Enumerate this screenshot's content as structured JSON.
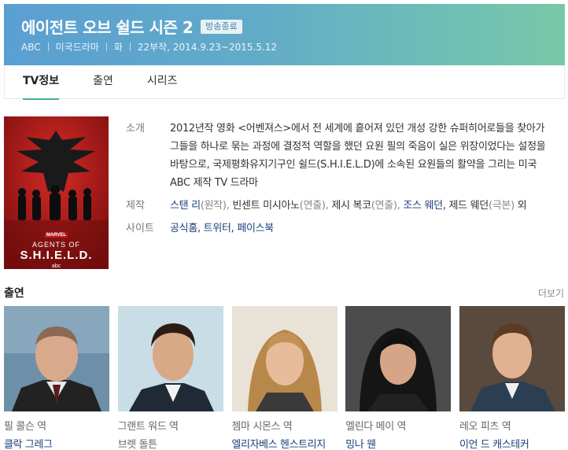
{
  "header": {
    "title": "에이전트 오브 쉴드 시즌 2",
    "badge": "방송종료",
    "meta": [
      "ABC",
      "미국드라마",
      "화",
      "22부작, 2014.9.23~2015.5.12"
    ]
  },
  "tabs": [
    {
      "label": "TV정보",
      "active": true
    },
    {
      "label": "출연",
      "active": false
    },
    {
      "label": "시리즈",
      "active": false
    }
  ],
  "poster": {
    "line1": "AGENTS OF",
    "line2": "S.H.I.E.L.D.",
    "brand": "MARVEL",
    "network": "abc"
  },
  "info": {
    "synopsis_label": "소개",
    "synopsis": "2012년작 영화 <어벤져스>에서 전 세계에 흩어져 있던 개성 강한 슈퍼히어로들을 찾아가 그들을 하나로 묶는 과정에 결정적 역할을 했던 요원 필의 죽음이 실은 위장이었다는 설정을 바탕으로, 국제평화유지기구인 쉴드(S.H.I.E.L.D)에 소속된 요원들의 활약을 그리는 미국 ABC 제작 TV 드라마",
    "production_label": "제작",
    "production": {
      "p1_name": "스탠 리",
      "p1_role": "(원작), ",
      "p2_name": "빈센트 미시아노",
      "p2_role": "(연출), ",
      "p3_name": "제시 복코",
      "p3_role": "(연출), ",
      "p4_name": "조스 웨던",
      "p4_sep": ", ",
      "p5_name": "제드 웨던",
      "p5_role": "(극본)",
      "suffix": " 외"
    },
    "site_label": "사이트",
    "sites": {
      "s1": "공식홈",
      "sep1": ", ",
      "s2": "트위터",
      "sep2": ", ",
      "s3": "페이스북"
    }
  },
  "cast_section": {
    "title": "출연",
    "more": "더보기"
  },
  "cast": [
    {
      "role": "필 콜슨 역",
      "name": "클락 그레그",
      "linked": true
    },
    {
      "role": "그랜트 워드 역",
      "name": "브렛 돌튼",
      "linked": false
    },
    {
      "role": "젬마 시몬스 역",
      "name": "엘리자베스 헨스트리지",
      "linked": true
    },
    {
      "role": "멜린다 메이 역",
      "name": "밍나 웬",
      "linked": true
    },
    {
      "role": "레오 피츠 역",
      "name": "이언 드 캐스테커",
      "linked": true
    }
  ],
  "colors": {
    "accent": "#3cb39a",
    "link": "#1a3f7a",
    "poster_red": "#b91c1c"
  }
}
